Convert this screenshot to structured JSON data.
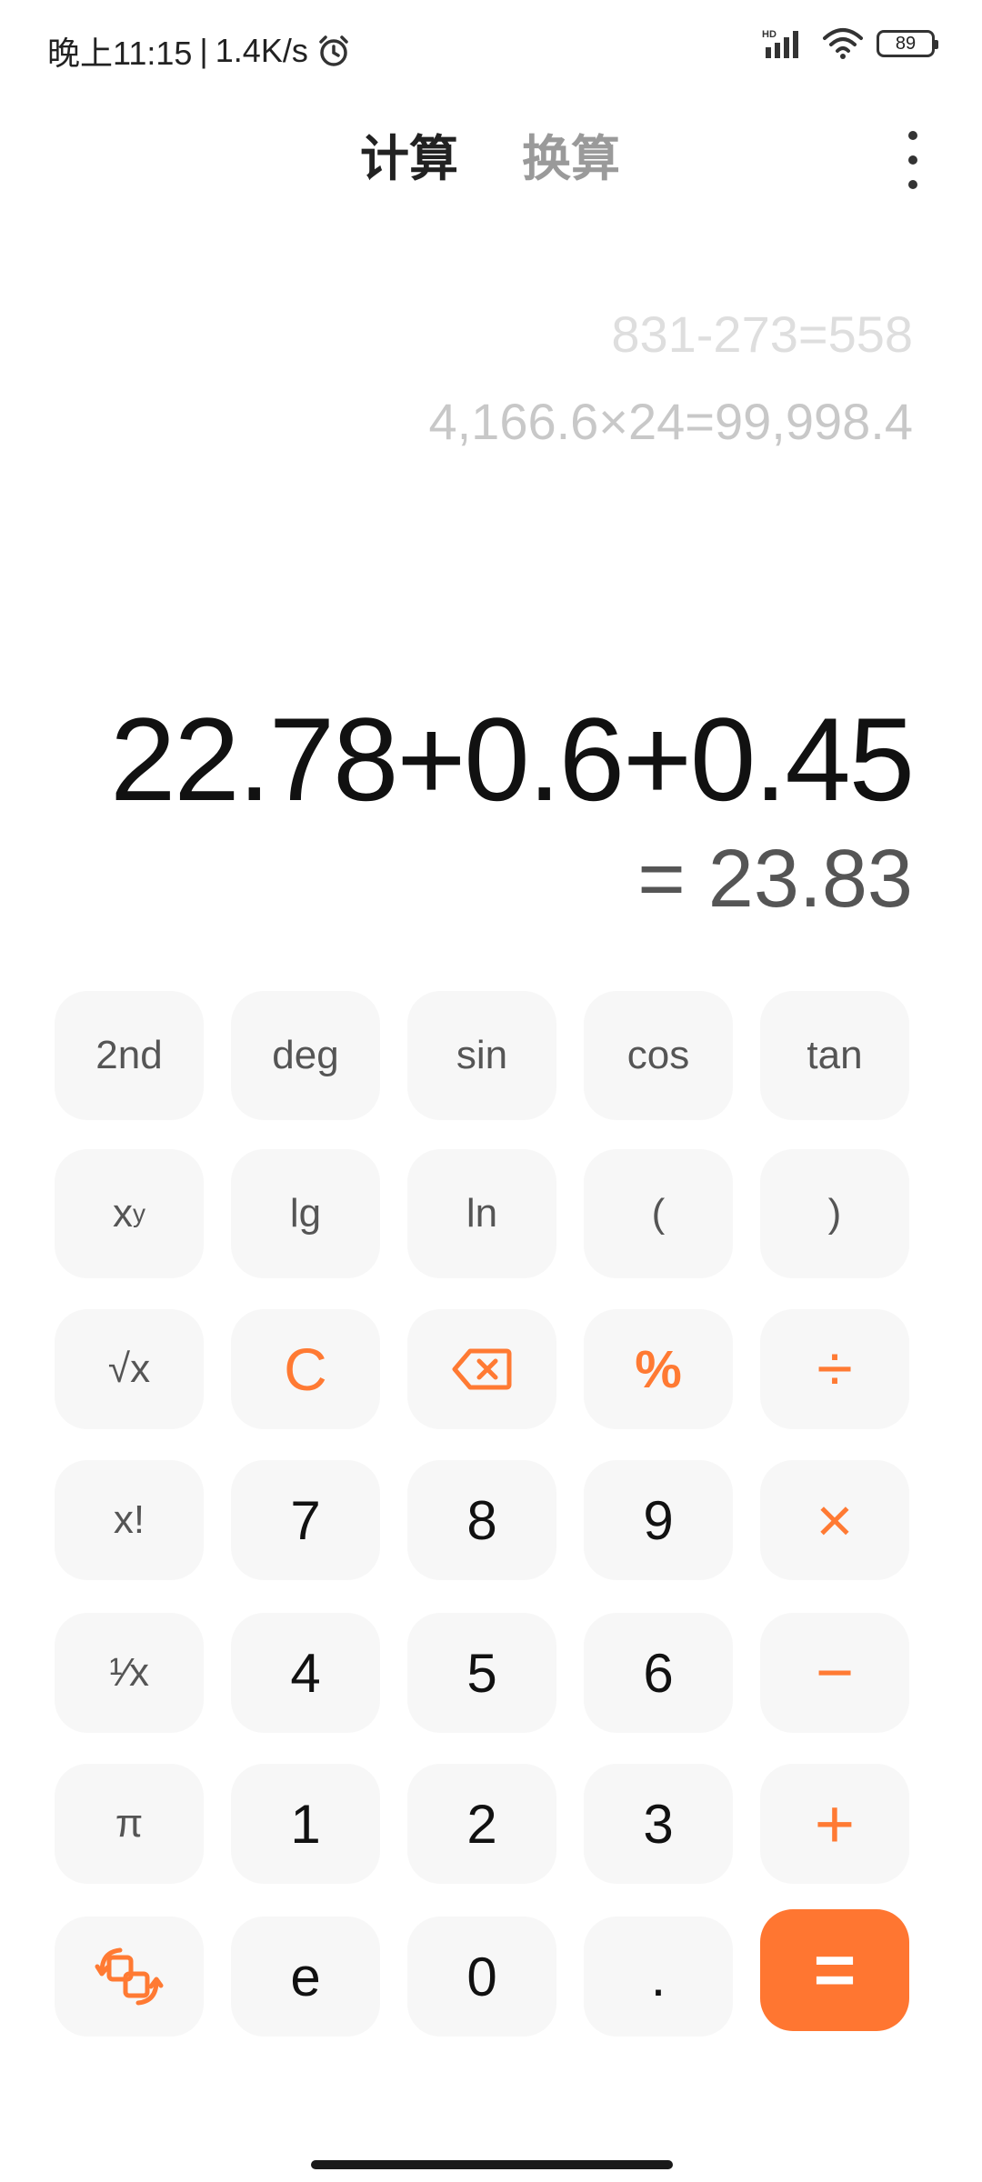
{
  "status_bar": {
    "time": "晚上11:15",
    "separator": "|",
    "net_speed": "1.4K/s",
    "battery_level": "89",
    "icons": [
      "alarm-icon",
      "hd-signal-icon",
      "wifi-icon",
      "battery-icon"
    ]
  },
  "tabs": {
    "calculate": "计算",
    "convert": "换算",
    "active": "计算"
  },
  "menu": {
    "icon": "more-vertical-icon"
  },
  "history": [
    "831-273=558",
    "4,166.6×24=99,998.4"
  ],
  "display": {
    "expression": "22.78+0.6+0.45",
    "result": "= 23.83"
  },
  "keys": {
    "second": "2nd",
    "deg": "deg",
    "sin": "sin",
    "cos": "cos",
    "tan": "tan",
    "power_base": "x",
    "power_exp": "y",
    "lg": "lg",
    "ln": "ln",
    "open_paren": "(",
    "close_paren": ")",
    "sqrt": "√x",
    "clear": "C",
    "backspace_icon": "backspace-icon",
    "percent": "%",
    "divide": "÷",
    "factorial": "x!",
    "seven": "7",
    "eight": "8",
    "nine": "9",
    "multiply": "×",
    "reciprocal": "¹⁄x",
    "four": "4",
    "five": "5",
    "six": "6",
    "minus": "−",
    "pi": "π",
    "one": "1",
    "two": "2",
    "three": "3",
    "plus": "+",
    "switch_icon": "switch-mode-icon",
    "e": "e",
    "zero": "0",
    "dot": ".",
    "equals": "="
  },
  "colors": {
    "accent": "#ff7631",
    "key_background": "#f7f7f7",
    "history_text": "#c8c8c8"
  }
}
